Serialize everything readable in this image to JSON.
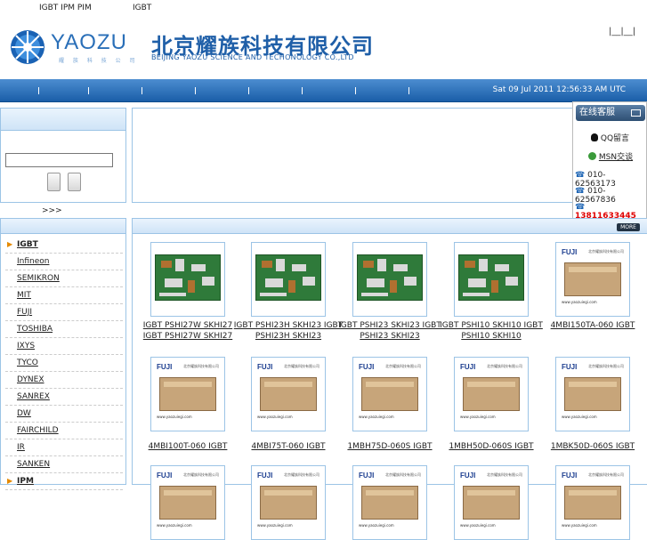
{
  "topbar": {
    "items": [
      "IGBT IPM PIM",
      "IGBT"
    ]
  },
  "logo": {
    "en": "YAOZU",
    "cn": "北京耀族科技有限公司",
    "en_full": "BEIJING YAOZU SCIENCE AND TECHONOLOGY CO.,LTD",
    "tagline": "耀 族 科 技 公 司"
  },
  "toplinks": "|__|__|",
  "nav": {
    "datetime": "Sat 09 Jul 2011 12:56:33 AM UTC"
  },
  "login": {
    "more": ">>>"
  },
  "service": {
    "title": "在线客服",
    "qq": "QQ留言",
    "msn": "MSN交谈",
    "phones": [
      "010-62563173",
      "010-62567836",
      "13811633445"
    ],
    "hotline_color": "#e00000"
  },
  "categories": [
    {
      "label": "IGBT",
      "active": true
    },
    {
      "label": "Infineon"
    },
    {
      "label": "SEMIKRON"
    },
    {
      "label": "MIT"
    },
    {
      "label": "FUJI"
    },
    {
      "label": "TOSHIBA"
    },
    {
      "label": "IXYS"
    },
    {
      "label": "TYCO"
    },
    {
      "label": "DYNEX"
    },
    {
      "label": "SANREX"
    },
    {
      "label": "DW"
    },
    {
      "label": "FAIRCHILD"
    },
    {
      "label": "IR"
    },
    {
      "label": "SANKEN"
    },
    {
      "label": "IPM",
      "active": true
    }
  ],
  "products_more": "MORE",
  "products": [
    {
      "name": "IGBT PSHI27W SKHI27 IGBT PSHI27W SKHI27",
      "kind": "pcb"
    },
    {
      "name": "IGBT PSHI23H SKHI23 IGBT PSHI23H SKHI23",
      "kind": "pcb"
    },
    {
      "name": "IGBT PSHI23 SKHI23 IGBT PSHI23 SKHI23",
      "kind": "pcb"
    },
    {
      "name": "IGBT PSHI10 SKHI10 IGBT PSHI10 SKHI10",
      "kind": "pcb"
    },
    {
      "name": "4MBI150TA-060 IGBT",
      "kind": "module"
    },
    {
      "name": "4MBI100T-060 IGBT",
      "kind": "module"
    },
    {
      "name": "4MBI75T-060 IGBT",
      "kind": "module"
    },
    {
      "name": "1MBH75D-060S IGBT",
      "kind": "module"
    },
    {
      "name": "1MBH50D-060S IGBT",
      "kind": "module"
    },
    {
      "name": "1MBK50D-060S IGBT",
      "kind": "module"
    }
  ],
  "module_label": {
    "brand": "FUJI",
    "cn": "北京耀族科技有限公司",
    "url": "www.yaozuiegi.com"
  }
}
